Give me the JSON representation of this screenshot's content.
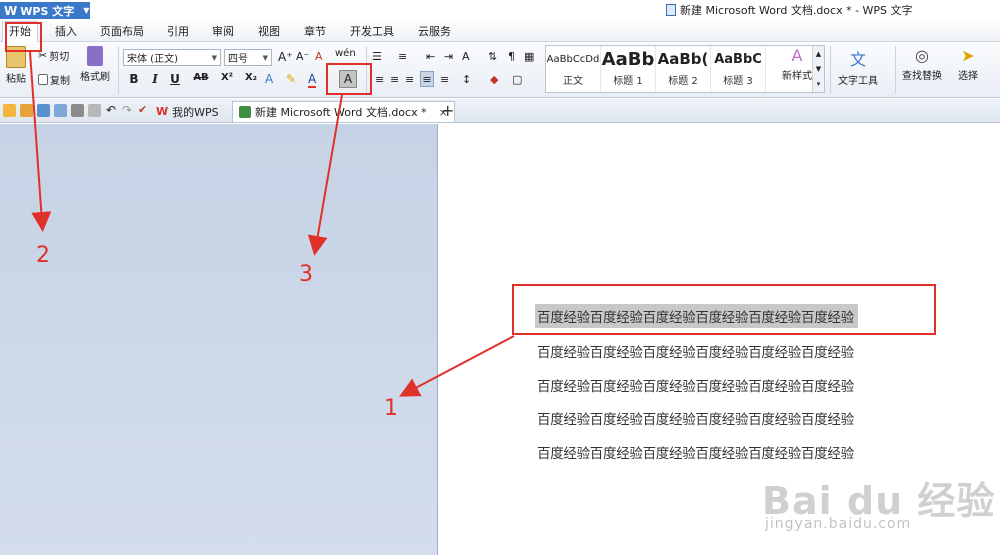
{
  "app": {
    "menu_button_label": "WPS 文字",
    "window_title": "新建 Microsoft Word 文档.docx * - WPS 文字"
  },
  "menu_tabs": [
    "开始",
    "插入",
    "页面布局",
    "引用",
    "审阅",
    "视图",
    "章节",
    "开发工具",
    "云服务"
  ],
  "ribbon": {
    "paste_label": "粘贴",
    "cut_label": "剪切",
    "copy_label": "复制",
    "format_painter_label": "格式刷",
    "font_name": "宋体 (正文)",
    "font_size": "四号",
    "bold": "B",
    "italic": "I",
    "underline": "U",
    "strikethrough": "AB",
    "superscript": "X²",
    "subscript": "X₂",
    "char_shading": "A",
    "styles": [
      {
        "sample": "AaBbCcDd",
        "name": "正文"
      },
      {
        "sample": "AaBb",
        "name": "标题 1"
      },
      {
        "sample": "AaBb(",
        "name": "标题 2"
      },
      {
        "sample": "AaBbC",
        "name": "标题 3"
      }
    ],
    "new_style_label": "新样式",
    "text_tools_label": "文字工具",
    "find_replace_label": "查找替换",
    "select_label": "选择"
  },
  "doc_tabs": [
    {
      "label": "我的WPS",
      "close": "×"
    },
    {
      "label": "新建 Microsoft Word 文档.docx *",
      "close": "×"
    }
  ],
  "new_tab_symbol": "+",
  "document": {
    "paragraphs": [
      "百度经验百度经验百度经验百度经验百度经验百度经验",
      "百度经验百度经验百度经验百度经验百度经验百度经验",
      "百度经验百度经验百度经验百度经验百度经验百度经验",
      "百度经验百度经验百度经验百度经验百度经验百度经验",
      "百度经验百度经验百度经验百度经验百度经验百度经验"
    ]
  },
  "annotations": {
    "labels": [
      "1",
      "2",
      "3"
    ],
    "color": "#e0302a"
  },
  "watermark": {
    "logo_text": "Bai du 经验",
    "url": "jingyan.baidu.com"
  },
  "colors": {
    "accent": "#3a78c9",
    "selection": "#c8c8c8",
    "left_pane": "#c6d3e6"
  }
}
